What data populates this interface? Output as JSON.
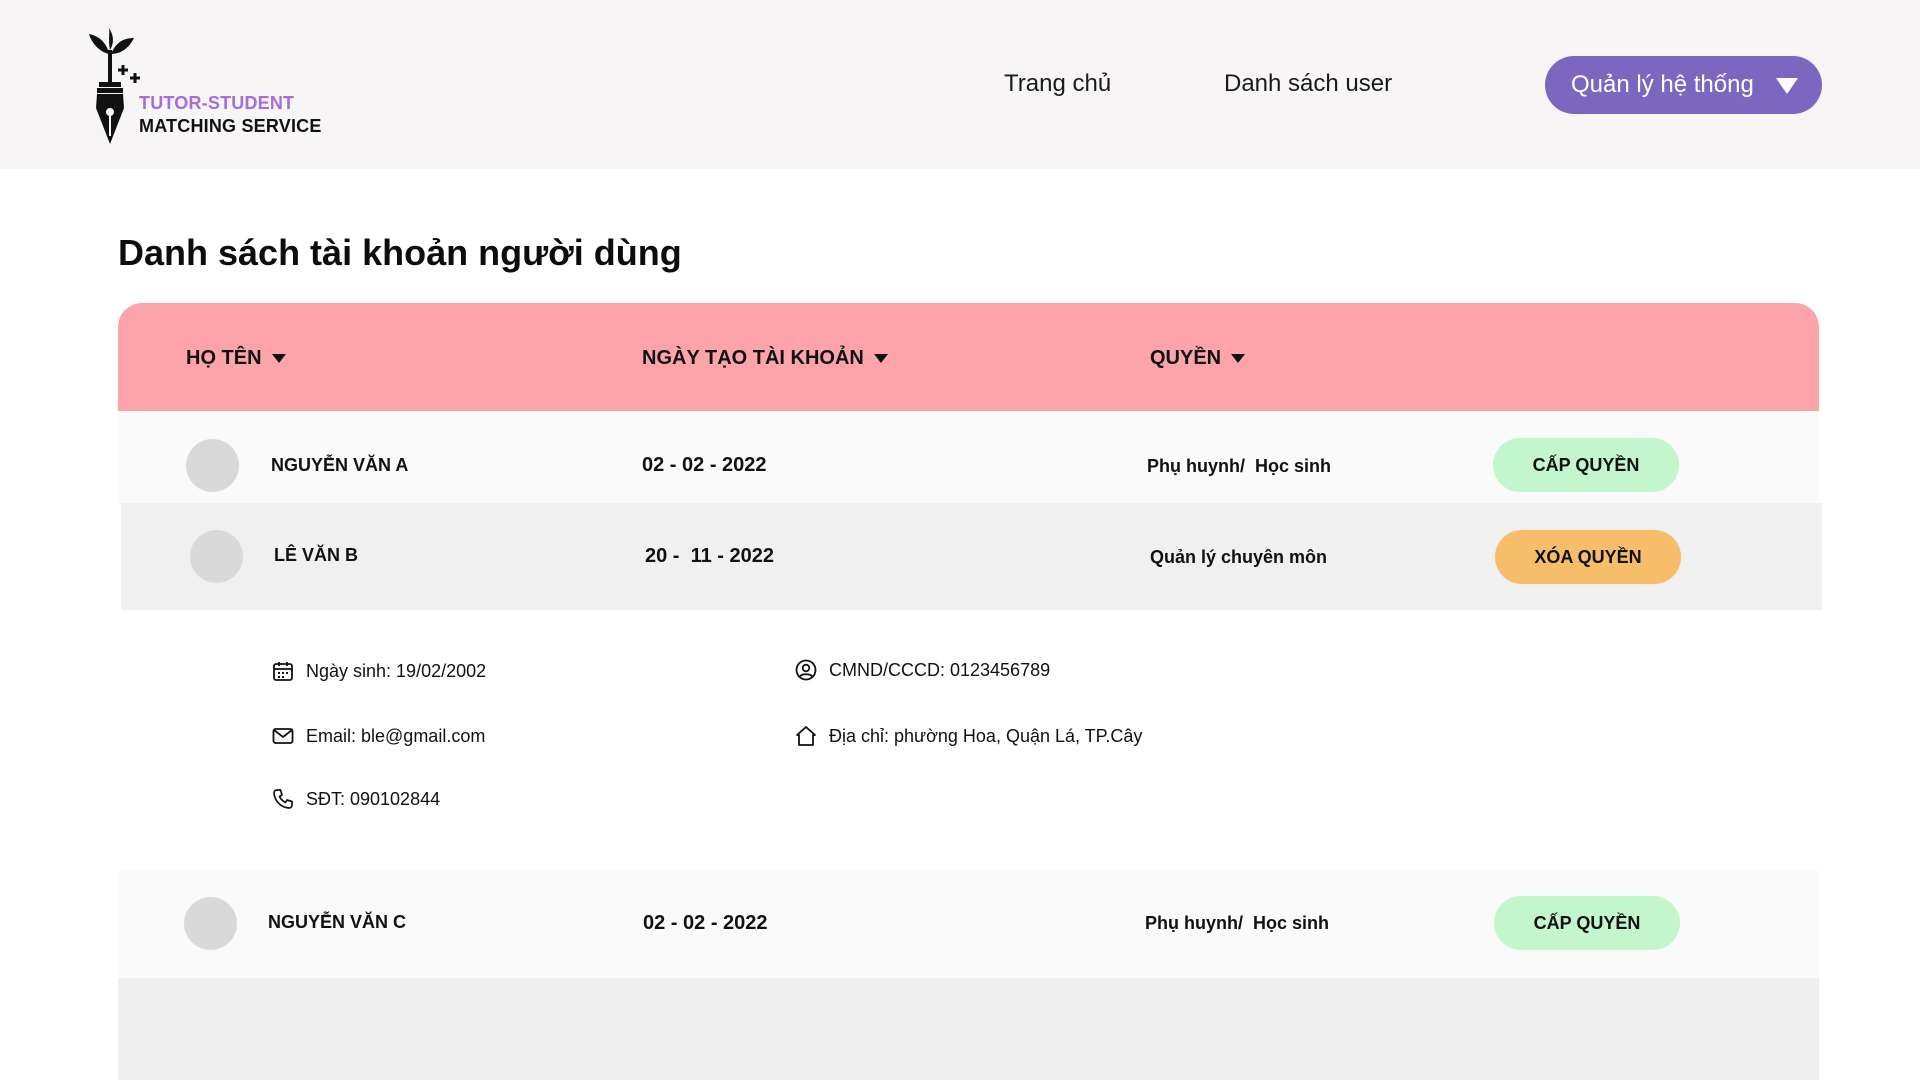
{
  "brand": {
    "line1": "TUTOR-STUDENT",
    "line2": "MATCHING SERVICE",
    "logo_icon": "pen-nib-plant-icon",
    "accent_color": "#a66ddb"
  },
  "nav": {
    "home_label": "Trang chủ",
    "users_label": "Danh sách user",
    "admin_label": "Quản lý hệ thống",
    "admin_color": "#7b67c0"
  },
  "page": {
    "title": "Danh sách tài khoản người dùng"
  },
  "table": {
    "header_color": "#fda4aa",
    "columns": [
      "HỌ TÊN",
      "NGÀY TẠO TÀI KHOẢN",
      "QUYỀN"
    ],
    "rows": [
      {
        "name": "NGUYỄN VĂN A",
        "created": "02 - 02 - 2022",
        "role": "Phụ huynh/  Học sinh",
        "action": "CẤP QUYỀN"
      },
      {
        "name": "LÊ VĂN B",
        "created": "20 -  11 - 2022",
        "role": "Quản lý chuyên môn",
        "action": "XÓA QUYỀN"
      },
      {
        "name": "NGUYỄN VĂN C",
        "created": "02 - 02 - 2022",
        "role": "Phụ huynh/  Học sinh",
        "action": "CẤP QUYỀN"
      }
    ]
  },
  "details": {
    "birthday": "Ngày sinh: 19/02/2002",
    "email": "Email: ble@gmail.com",
    "phone": "SĐT: 090102844",
    "id_card": "CMND/CCCD: 0123456789",
    "address": "Địa chỉ: phường Hoa, Quận Lá, TP.Cây"
  },
  "colors": {
    "grant_button": "#c3f6cd",
    "revoke_button": "#f6bd6a"
  }
}
